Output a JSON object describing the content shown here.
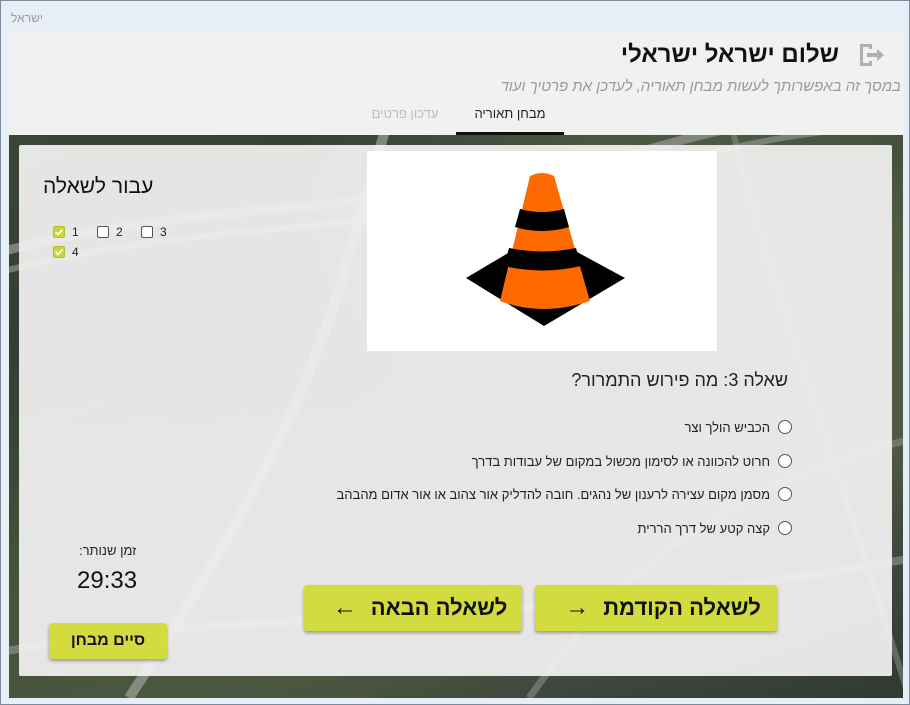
{
  "window": {
    "title": "ישראל"
  },
  "header": {
    "greeting": "שלום ישראל ישראלי",
    "subtitle": "במסך זה באפשרותך לעשות מבחן תאוריה, לעדכן את פרטיך ועוד",
    "exit_icon": "exit-icon"
  },
  "tabs": [
    {
      "label": "מבחן תאוריה",
      "active": true
    },
    {
      "label": "עדכון פרטים",
      "active": false
    }
  ],
  "question": {
    "title": "שאלה 3: מה פירוש התמרור?",
    "image": "traffic-cone",
    "answers": [
      "הכביש הולך וצר",
      "חרוט להכוונה או לסימון מכשול במקום של עבודות בדרך",
      "מסמן מקום עצירה לרענון של נהגים. חובה להדליק אור צהוב או אור אדום מהבהב",
      "קצה קטע של דרך הררית"
    ]
  },
  "navigator": {
    "title": "עבור לשאלה",
    "questions": [
      {
        "label": "1",
        "checked": true
      },
      {
        "label": "2",
        "checked": false
      },
      {
        "label": "3",
        "checked": false
      },
      {
        "label": "4",
        "checked": true
      }
    ]
  },
  "timer": {
    "label": "זמן שנותר:",
    "value": "29:33"
  },
  "buttons": {
    "prev": "לשאלה הקודמת",
    "next": "לשאלה הבאה",
    "finish": "סיים מבחן"
  },
  "colors": {
    "accent": "#d2dc3e",
    "cone_orange": "#ff6a00",
    "cone_black": "#000000"
  }
}
